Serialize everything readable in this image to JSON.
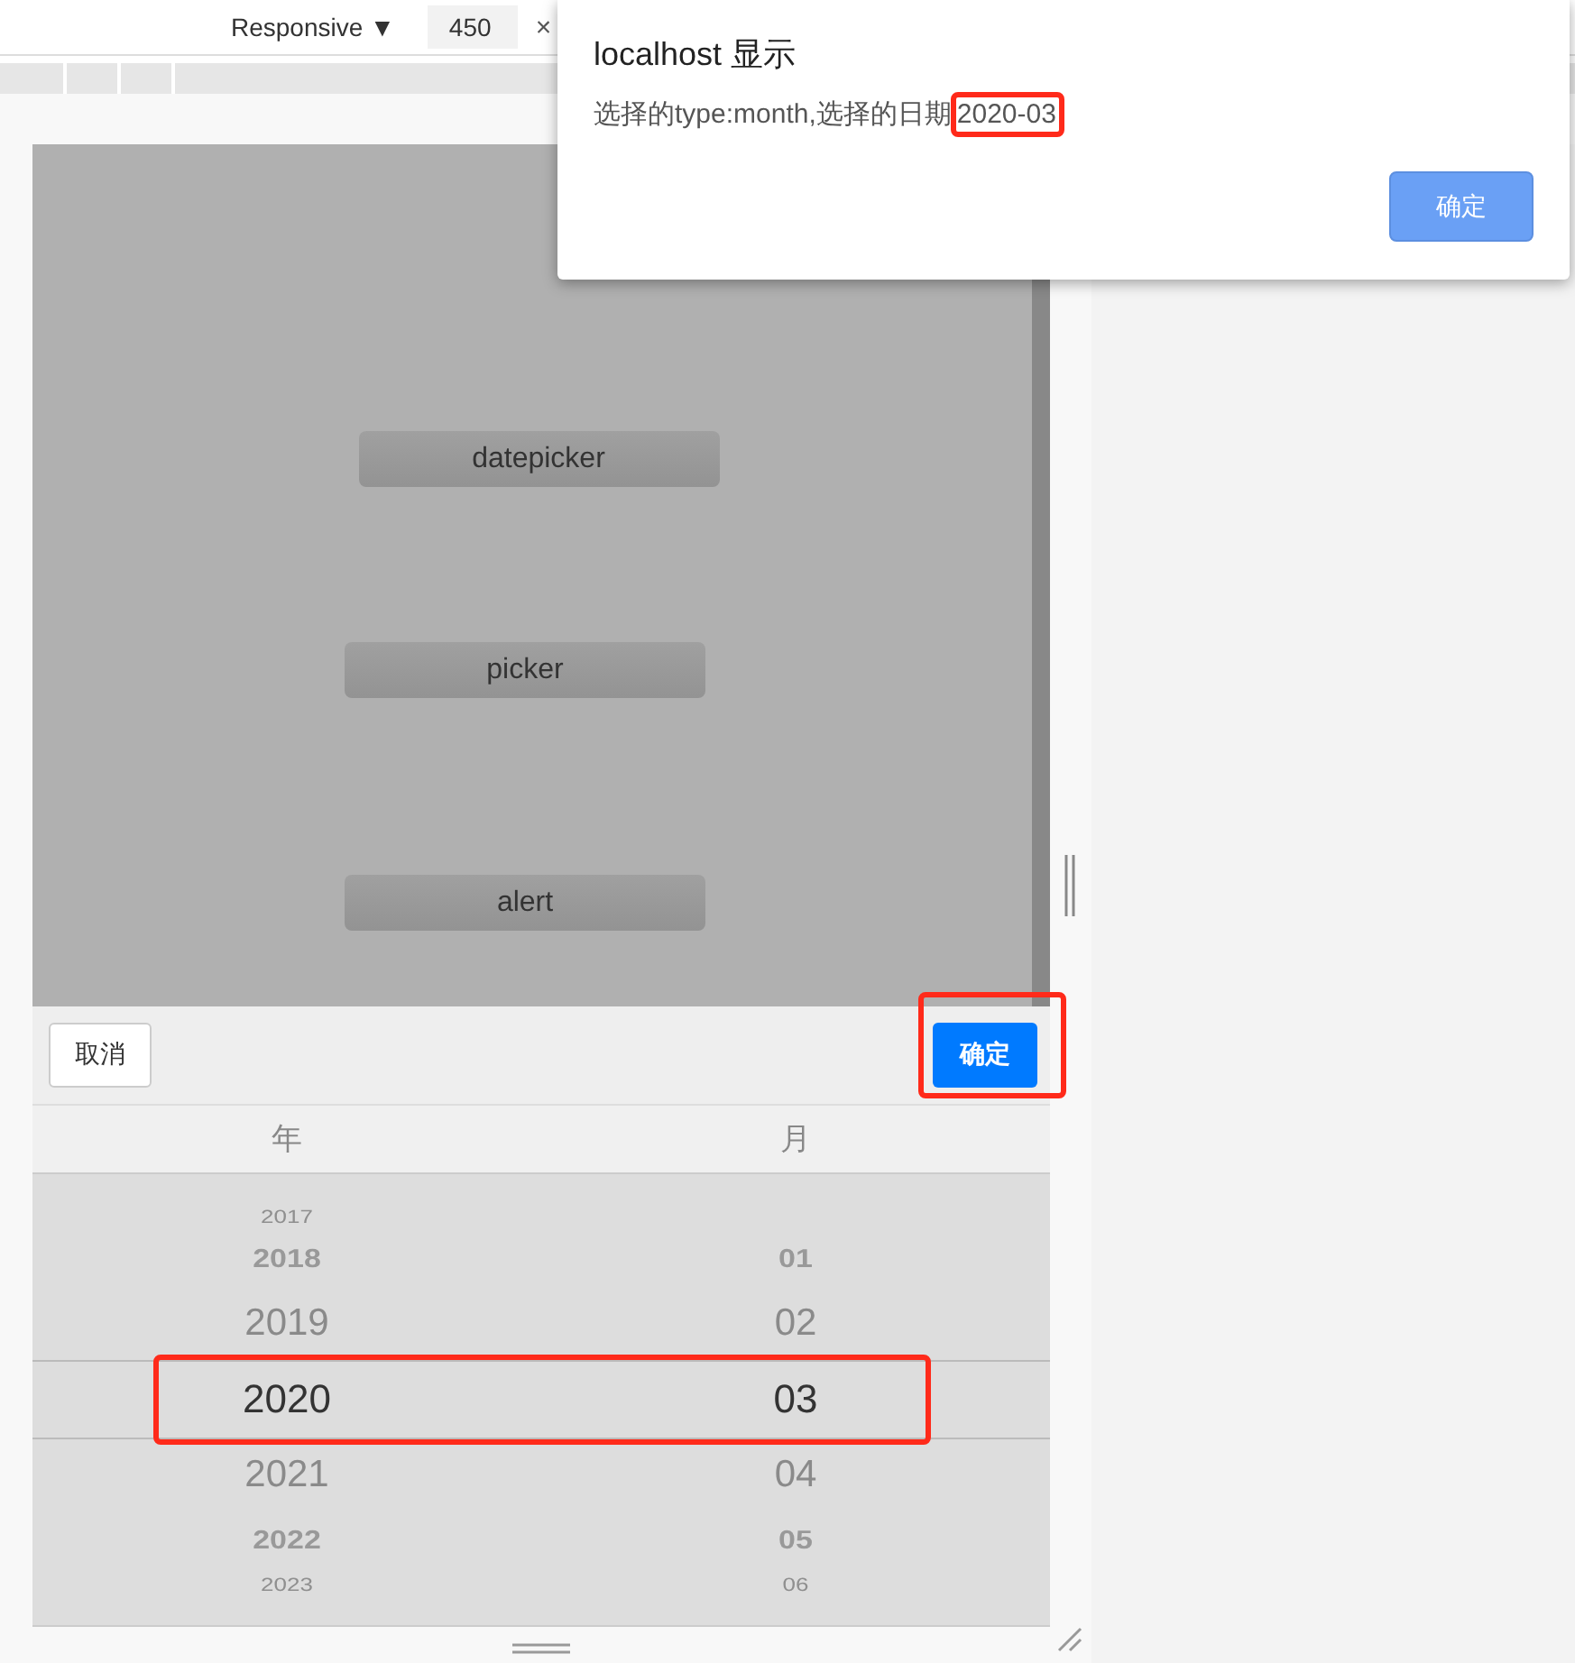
{
  "devtools_bar": {
    "device": "Responsive ▼",
    "width_value": "450",
    "close": "×"
  },
  "page_buttons": [
    "datepicker",
    "picker",
    "alert"
  ],
  "picker": {
    "cancel": "取消",
    "confirm": {
      "label": "确定",
      "highlighted": true
    },
    "columns": [
      "年",
      "月"
    ],
    "rows": [
      {
        "year": "2017",
        "selected": false
      },
      {
        "year": "2018",
        "month": "01",
        "selected": false
      },
      {
        "year": "2019",
        "month": "02",
        "selected": false
      },
      {
        "year": "2020",
        "month": "03",
        "selected": true,
        "highlighted": true
      },
      {
        "year": "2021",
        "month": "04",
        "selected": false
      },
      {
        "year": "2022",
        "month": "05",
        "selected": false
      },
      {
        "year": "2023",
        "month": "06",
        "selected": false
      }
    ]
  },
  "alert": {
    "title": "localhost 显示",
    "message": "选择的type:month,选择的日期",
    "value": {
      "text": "2020-03",
      "highlighted": true
    },
    "ok": "确定"
  }
}
